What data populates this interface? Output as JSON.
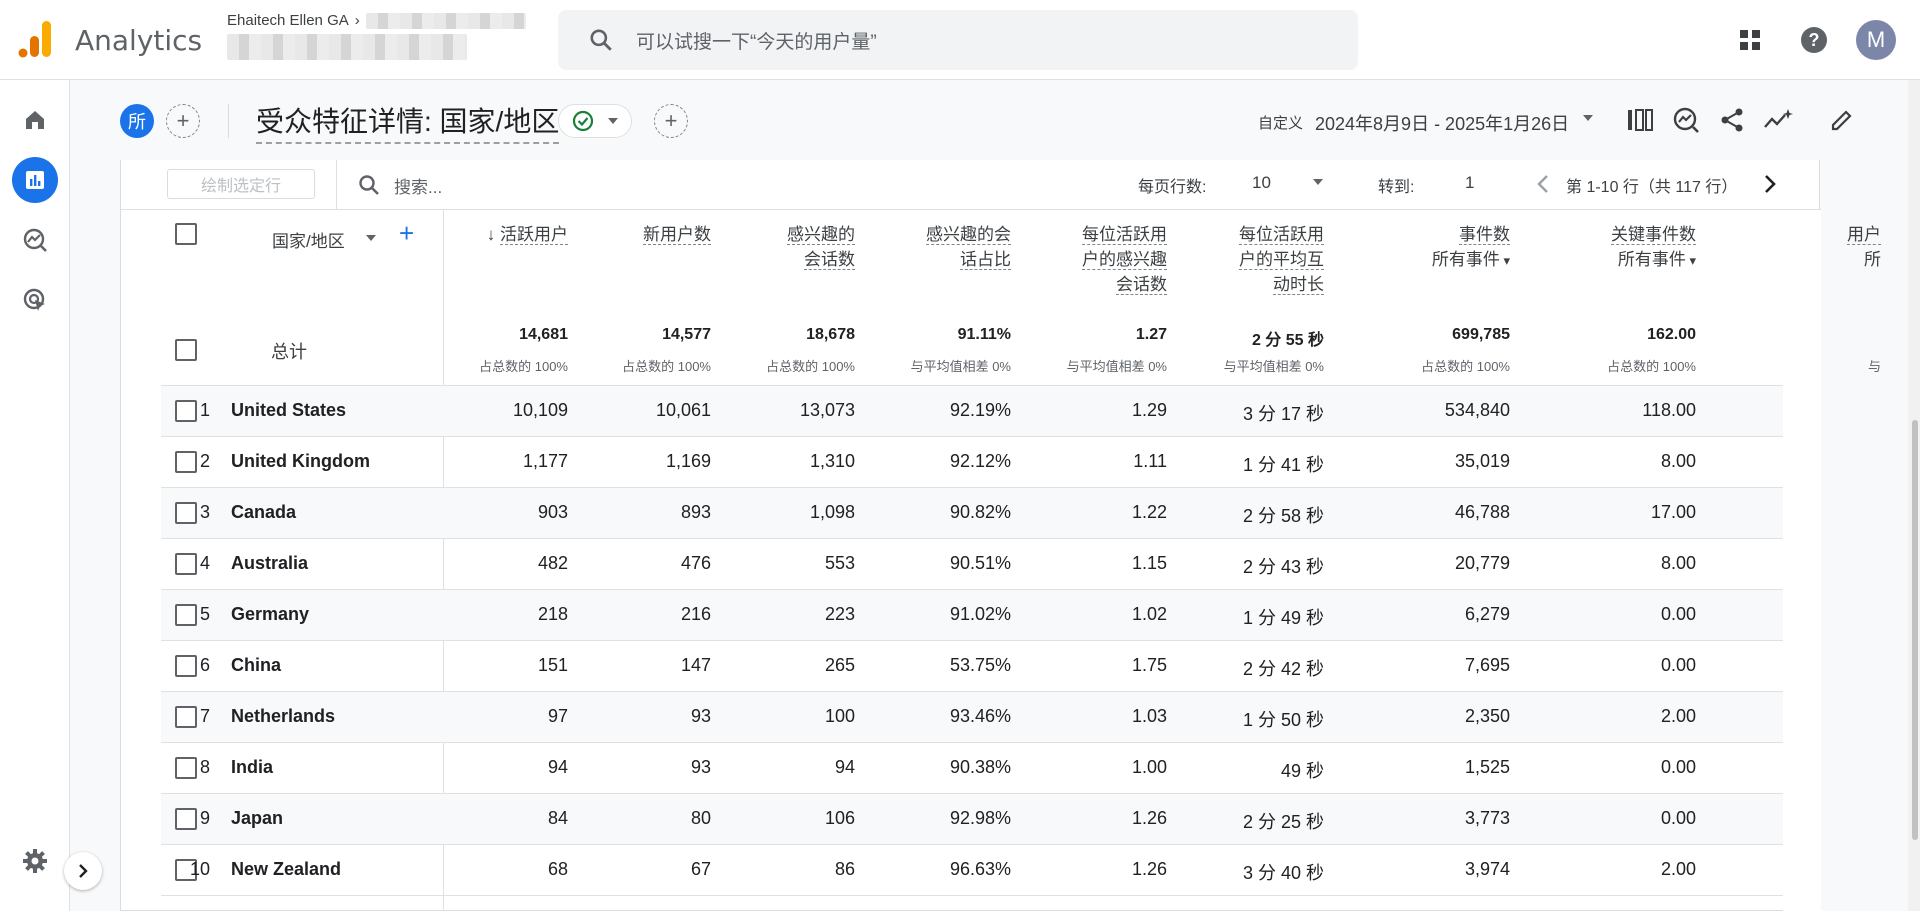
{
  "app": {
    "brand": "Analytics",
    "account_name": "Ehaitech Ellen GA"
  },
  "search": {
    "placeholder": "可以试搜一下“今天的用户量”"
  },
  "header": {
    "segment_badge": "所",
    "title": "受众特征详情: 国家/地区",
    "date_label": "自定义",
    "date_range": "2024年8月9日 - 2025年1月26日"
  },
  "user": {
    "avatar_letter": "M"
  },
  "toolbar": {
    "plot_rows": "绘制选定行",
    "search_placeholder": "搜索...",
    "rows_per_page_label": "每页行数:",
    "rows_per_page": "10",
    "goto_label": "转到:",
    "goto_value": "1",
    "page_info": "第 1-10 行（共 117 行）"
  },
  "table": {
    "dimension_header": "国家/地区",
    "columns": [
      {
        "lines": [
          "活跃用户"
        ],
        "sort": true
      },
      {
        "lines": [
          "新用户数"
        ]
      },
      {
        "lines": [
          "感兴趣的",
          "会话数"
        ]
      },
      {
        "lines": [
          "感兴趣的会",
          "话占比"
        ]
      },
      {
        "lines": [
          "每位活跃用",
          "户的感兴趣",
          "会话数"
        ]
      },
      {
        "lines": [
          "每位活跃用",
          "户的平均互",
          "动时长"
        ]
      },
      {
        "lines": [
          "事件数"
        ],
        "sub": "所有事件"
      },
      {
        "lines": [
          "关键事件数"
        ],
        "sub": "所有事件"
      },
      {
        "lines": [
          "用户"
        ],
        "sub": "所"
      }
    ],
    "totals_label": "总计",
    "totals": [
      "14,681",
      "14,577",
      "18,678",
      "91.11%",
      "1.27",
      "2 分 55 秒",
      "699,785",
      "162.00"
    ],
    "totals_sub": [
      "占总数的 100%",
      "占总数的 100%",
      "占总数的 100%",
      "与平均值相差 0%",
      "与平均值相差 0%",
      "与平均值相差 0%",
      "占总数的 100%",
      "占总数的 100%",
      "与"
    ],
    "rows": [
      {
        "idx": "1",
        "country": "United States",
        "values": [
          "10,109",
          "10,061",
          "13,073",
          "92.19%",
          "1.29",
          "3 分 17 秒",
          "534,840",
          "118.00"
        ]
      },
      {
        "idx": "2",
        "country": "United Kingdom",
        "values": [
          "1,177",
          "1,169",
          "1,310",
          "92.12%",
          "1.11",
          "1 分 41 秒",
          "35,019",
          "8.00"
        ]
      },
      {
        "idx": "3",
        "country": "Canada",
        "values": [
          "903",
          "893",
          "1,098",
          "90.82%",
          "1.22",
          "2 分 58 秒",
          "46,788",
          "17.00"
        ]
      },
      {
        "idx": "4",
        "country": "Australia",
        "values": [
          "482",
          "476",
          "553",
          "90.51%",
          "1.15",
          "2 分 43 秒",
          "20,779",
          "8.00"
        ]
      },
      {
        "idx": "5",
        "country": "Germany",
        "values": [
          "218",
          "216",
          "223",
          "91.02%",
          "1.02",
          "1 分 49 秒",
          "6,279",
          "0.00"
        ]
      },
      {
        "idx": "6",
        "country": "China",
        "values": [
          "151",
          "147",
          "265",
          "53.75%",
          "1.75",
          "2 分 42 秒",
          "7,695",
          "0.00"
        ]
      },
      {
        "idx": "7",
        "country": "Netherlands",
        "values": [
          "97",
          "93",
          "100",
          "93.46%",
          "1.03",
          "1 分 50 秒",
          "2,350",
          "2.00"
        ]
      },
      {
        "idx": "8",
        "country": "India",
        "values": [
          "94",
          "93",
          "94",
          "90.38%",
          "1.00",
          "49 秒",
          "1,525",
          "0.00"
        ]
      },
      {
        "idx": "9",
        "country": "Japan",
        "values": [
          "84",
          "80",
          "106",
          "92.98%",
          "1.26",
          "2 分 25 秒",
          "3,773",
          "0.00"
        ]
      },
      {
        "idx": "10",
        "country": "New Zealand",
        "values": [
          "68",
          "67",
          "86",
          "96.63%",
          "1.26",
          "3 分 40 秒",
          "3,974",
          "2.00"
        ]
      }
    ]
  },
  "colors": {
    "accent": "#1a73e8",
    "logo_orange": "#f9ab00",
    "logo_dark": "#e37400"
  }
}
